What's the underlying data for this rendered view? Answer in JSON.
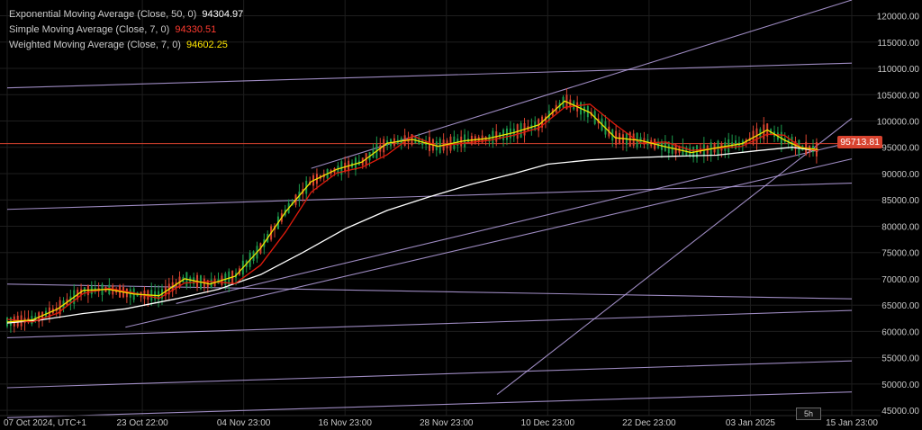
{
  "legend": [
    {
      "label": "Exponential Moving Average (Close, 50, 0)",
      "value": "94304.97",
      "color": "#ffffff"
    },
    {
      "label": "Simple Moving Average (Close, 7, 0)",
      "value": "94330.51",
      "color": "#ff3b30"
    },
    {
      "label": "Weighted Moving Average (Close, 7, 0)",
      "value": "94602.25",
      "color": "#ffe600"
    }
  ],
  "current_price": "95713.81",
  "timeframe": "5h",
  "colors": {
    "background": "#000000",
    "grid": "#1e1e1e",
    "trendline": "#b9a3e3",
    "price_line": "#d8432f",
    "ema": "#ffffff",
    "sma": "#e11b0c",
    "wma": "#f2e500",
    "bull": "#1c9a4c",
    "bear": "#d8432f",
    "axis_text": "#c8c8c8"
  },
  "chart_data": {
    "type": "line",
    "title": "",
    "xlabel": "",
    "ylabel": "",
    "ylim": [
      44000,
      123000
    ],
    "xlim": [
      "2024-10-07",
      "2025-01-15"
    ],
    "y_ticks": [
      "120000.00",
      "115000.00",
      "110000.00",
      "105000.00",
      "100000.00",
      "95000.00",
      "90000.00",
      "85000.00",
      "80000.00",
      "75000.00",
      "70000.00",
      "65000.00",
      "60000.00",
      "55000.00",
      "50000.00",
      "45000.00"
    ],
    "x_ticks": [
      {
        "date": "2024-10-07",
        "label": "07 Oct 2024, UTC+1"
      },
      {
        "date": "2024-10-23",
        "label": "23 Oct 22:00"
      },
      {
        "date": "2024-11-04",
        "label": "04 Nov 23:00"
      },
      {
        "date": "2024-11-16",
        "label": "16 Nov 23:00"
      },
      {
        "date": "2024-11-28",
        "label": "28 Nov 23:00"
      },
      {
        "date": "2024-12-10",
        "label": "10 Dec 23:00"
      },
      {
        "date": "2024-12-22",
        "label": "22 Dec 23:00"
      },
      {
        "date": "2025-01-03",
        "label": "03 Jan 2025"
      },
      {
        "date": "2025-01-15",
        "label": "15 Jan 23:00"
      }
    ],
    "horizontal_line": 95713.81,
    "series": [
      {
        "name": "Exponential Moving Average (Close, 50, 0)",
        "color": "#ffffff",
        "x": [
          "2024-10-07",
          "2024-10-11",
          "2024-10-16",
          "2024-10-21",
          "2024-10-27",
          "2024-11-01",
          "2024-11-06",
          "2024-11-11",
          "2024-11-16",
          "2024-11-21",
          "2024-11-26",
          "2024-12-01",
          "2024-12-06",
          "2024-12-10",
          "2024-12-15",
          "2024-12-20",
          "2024-12-25",
          "2024-12-30",
          "2025-01-04",
          "2025-01-08",
          "2025-01-11"
        ],
        "values": [
          61600,
          62200,
          63400,
          64300,
          66200,
          68000,
          70800,
          75000,
          79500,
          83000,
          85600,
          88000,
          90000,
          91800,
          92600,
          93000,
          93300,
          93500,
          94400,
          95000,
          94300
        ]
      },
      {
        "name": "Simple Moving Average (Close, 7, 0)",
        "color": "#e11b0c",
        "x": [
          "2024-10-07",
          "2024-10-10",
          "2024-10-13",
          "2024-10-16",
          "2024-10-19",
          "2024-10-22",
          "2024-10-25",
          "2024-10-28",
          "2024-10-31",
          "2024-11-03",
          "2024-11-06",
          "2024-11-09",
          "2024-11-12",
          "2024-11-15",
          "2024-11-18",
          "2024-11-21",
          "2024-11-24",
          "2024-11-27",
          "2024-11-30",
          "2024-12-03",
          "2024-12-06",
          "2024-12-09",
          "2024-12-12",
          "2024-12-15",
          "2024-12-18",
          "2024-12-21",
          "2024-12-24",
          "2024-12-27",
          "2024-12-30",
          "2025-01-02",
          "2025-01-05",
          "2025-01-07",
          "2025-01-09",
          "2025-01-11"
        ],
        "values": [
          62300,
          61800,
          63500,
          67200,
          68200,
          67300,
          66300,
          69200,
          69500,
          69100,
          72600,
          79000,
          86500,
          90100,
          91200,
          93600,
          97200,
          95200,
          95800,
          96300,
          97300,
          98700,
          102600,
          103200,
          99300,
          95800,
          96000,
          94400,
          94800,
          95200,
          97500,
          97300,
          95000,
          94300
        ]
      },
      {
        "name": "Weighted Moving Average (Close, 7, 0)",
        "color": "#f2e500",
        "x": [
          "2024-10-07",
          "2024-10-10",
          "2024-10-13",
          "2024-10-16",
          "2024-10-19",
          "2024-10-22",
          "2024-10-25",
          "2024-10-28",
          "2024-10-31",
          "2024-11-03",
          "2024-11-06",
          "2024-11-09",
          "2024-11-12",
          "2024-11-15",
          "2024-11-18",
          "2024-11-21",
          "2024-11-24",
          "2024-11-27",
          "2024-11-30",
          "2024-12-03",
          "2024-12-06",
          "2024-12-09",
          "2024-12-12",
          "2024-12-15",
          "2024-12-18",
          "2024-12-21",
          "2024-12-24",
          "2024-12-27",
          "2024-12-30",
          "2025-01-02",
          "2025-01-05",
          "2025-01-07",
          "2025-01-09",
          "2025-01-11"
        ],
        "values": [
          61800,
          62200,
          64300,
          67800,
          68000,
          67100,
          66800,
          70000,
          69000,
          70500,
          75800,
          82800,
          88500,
          90800,
          92200,
          95800,
          96500,
          95200,
          96200,
          96700,
          97800,
          99300,
          103800,
          101600,
          96800,
          96300,
          95100,
          94000,
          94900,
          95700,
          98300,
          96400,
          94900,
          94600
        ]
      }
    ],
    "candles_bull_color": "#1c9a4c",
    "candles_bear_color": "#d8432f"
  }
}
